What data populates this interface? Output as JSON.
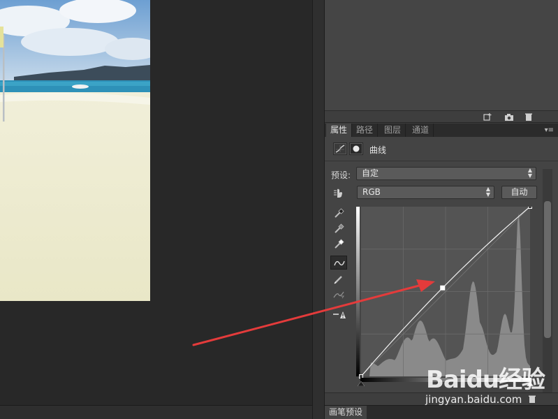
{
  "panel": {
    "tabs": [
      {
        "label": "属性",
        "active": true
      },
      {
        "label": "路径",
        "active": false
      },
      {
        "label": "图层",
        "active": false
      },
      {
        "label": "通道",
        "active": false
      }
    ],
    "menu_icon": "panel-menu-icon",
    "title": "曲线",
    "preset_label": "预设:",
    "preset_value": "自定",
    "channel_value": "RGB",
    "auto_label": "自动"
  },
  "tools": [
    "eyedropper-black-icon",
    "eyedropper-gray-icon",
    "eyedropper-white-icon",
    "curve-edit-points-icon",
    "pencil-draw-icon",
    "smooth-curve-icon",
    "clipping-warning-icon"
  ],
  "curve": {
    "points": [
      [
        0,
        0
      ],
      [
        123,
        133
      ],
      [
        255,
        255
      ]
    ],
    "highlighted_point": [
      123,
      133
    ]
  },
  "brush_panel": {
    "tab_label": "画笔预设"
  },
  "watermark": {
    "brand": "Baidu经验",
    "url": "jingyan.baidu.com"
  },
  "colors": {
    "annotation_arrow": "#e43b3b",
    "panel_bg": "#444444",
    "tab_active": "#444444"
  }
}
